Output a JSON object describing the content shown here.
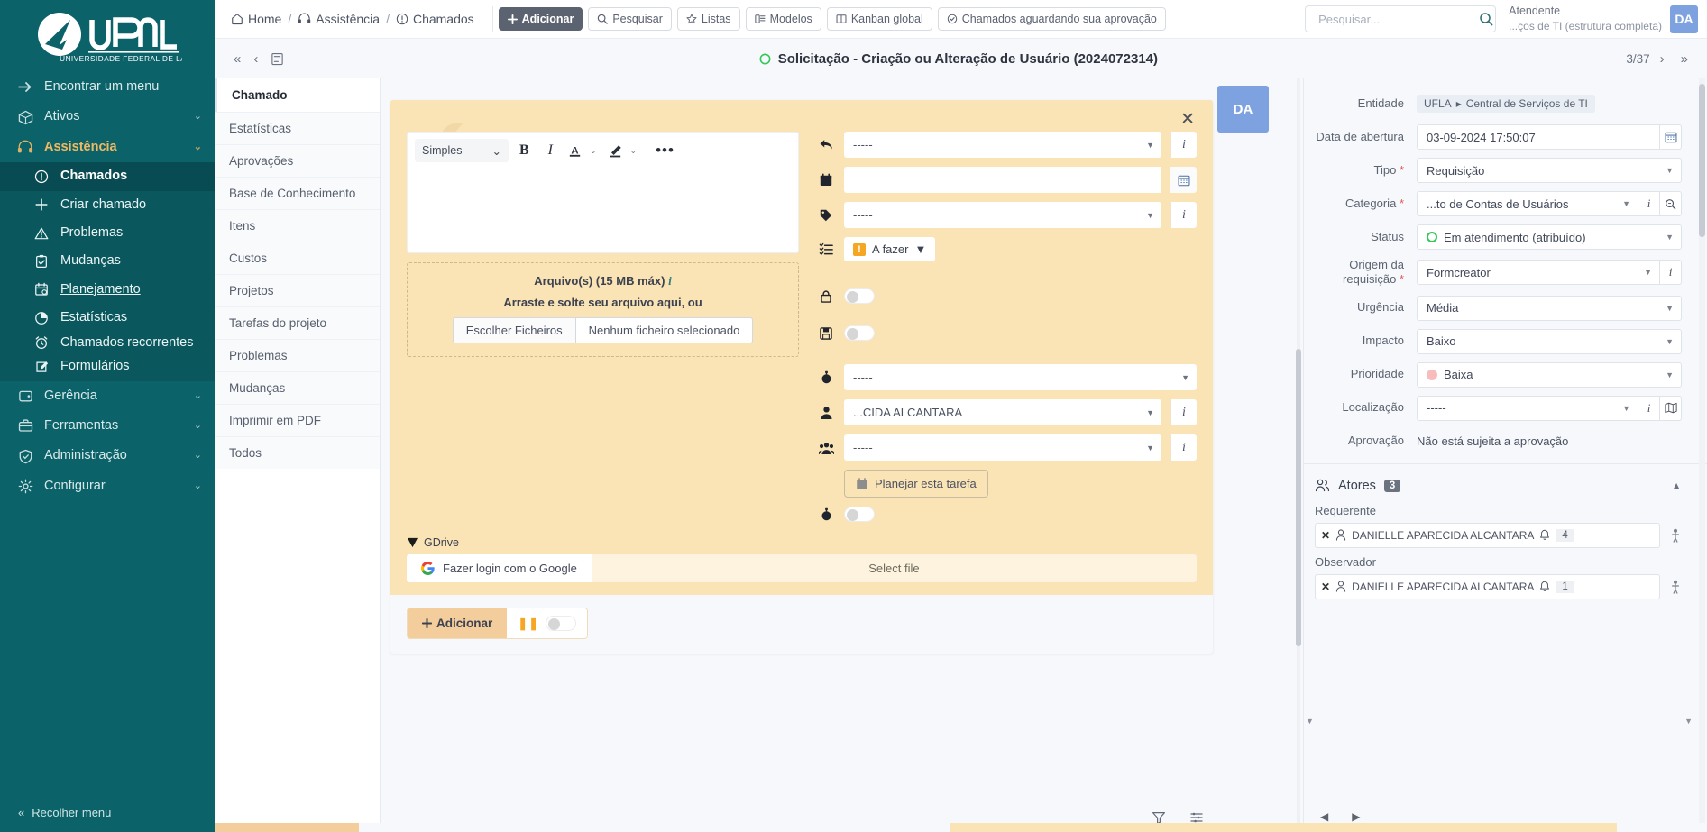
{
  "sidebar": {
    "logo_text": "UFLA",
    "logo_sub": "UNIVERSIDADE FEDERAL DE LAVRAS",
    "find_menu": "Encontrar um menu",
    "items": [
      {
        "label": "Ativos",
        "icon": "box-icon"
      },
      {
        "label": "Assistência",
        "icon": "headset-icon"
      }
    ],
    "sub_items": [
      {
        "label": "Chamados",
        "icon": "exclamation-circle-icon"
      },
      {
        "label": "Criar chamado",
        "icon": "plus-icon"
      },
      {
        "label": "Problemas",
        "icon": "warning-triangle-icon"
      },
      {
        "label": "Mudanças",
        "icon": "clipboard-check-icon"
      },
      {
        "label": "Planejamento",
        "icon": "calendar-clock-icon"
      },
      {
        "label": "Estatísticas",
        "icon": "pie-chart-icon"
      },
      {
        "label": "Chamados recorrentes",
        "icon": "alarm-clock-icon"
      },
      {
        "label": "Formulários",
        "icon": "edit-square-icon"
      }
    ],
    "items_after": [
      {
        "label": "Gerência",
        "icon": "wallet-icon"
      },
      {
        "label": "Ferramentas",
        "icon": "briefcase-icon"
      },
      {
        "label": "Administração",
        "icon": "shield-check-icon"
      },
      {
        "label": "Configurar",
        "icon": "gear-icon"
      }
    ],
    "collapse_label": "Recolher menu"
  },
  "topbar": {
    "breadcrumb": [
      {
        "label": "Home",
        "icon": "home-icon"
      },
      {
        "label": "Assistência",
        "icon": "headset-icon"
      },
      {
        "label": "Chamados",
        "icon": "exclamation-circle-icon"
      }
    ],
    "buttons": [
      {
        "label": "Adicionar",
        "icon": "plus-icon",
        "primary": true
      },
      {
        "label": "Pesquisar",
        "icon": "search-icon",
        "primary": false
      },
      {
        "label": "Listas",
        "icon": "star-icon",
        "primary": false
      },
      {
        "label": "Modelos",
        "icon": "template-icon",
        "primary": false
      },
      {
        "label": "Kanban global",
        "icon": "kanban-icon",
        "primary": false
      },
      {
        "label": "Chamados aguardando sua aprovação",
        "icon": "clock-check-icon",
        "primary": false
      }
    ],
    "search_placeholder": "Pesquisar...",
    "user_role": "Atendente",
    "user_entity": "...ços de TI (estrutura completa)",
    "user_initials": "DA"
  },
  "title_row": {
    "ticket_title": "Solicitação - Criação ou Alteração de Usuário (2024072314)",
    "status_icon": "green-ring-icon",
    "pager": "3/37"
  },
  "tabs": {
    "header": "Chamado",
    "items": [
      "Estatísticas",
      "Aprovações",
      "Base de Conhecimento",
      "Itens",
      "Custos",
      "Projetos",
      "Tarefas do projeto",
      "Problemas",
      "Mudanças",
      "Imprimir em PDF",
      "Todos"
    ]
  },
  "card": {
    "avatar_initials": "DA",
    "editor": {
      "style_select": "Simples",
      "bold": "B",
      "italic": "I",
      "more": "•••",
      "content": ""
    },
    "upload": {
      "title": "Arquivo(s) (15 MB máx)",
      "info": "i",
      "drop_text": "Arraste e solte seu arquivo aqui, ou",
      "choose_button": "Escolher Ficheiros",
      "no_file": "Nenhum ficheiro selecionado"
    },
    "controls": [
      {
        "icon": "reply-icon",
        "type": "select",
        "value": "-----",
        "has_info": true
      },
      {
        "icon": "calendar-icon",
        "type": "date",
        "value": "",
        "has_info": false
      },
      {
        "icon": "tag-icon",
        "type": "select",
        "value": "-----",
        "has_info": true
      },
      {
        "icon": "task-list-icon",
        "type": "pill",
        "value": "A fazer",
        "badge": "!"
      },
      {
        "icon": "lock-icon",
        "type": "toggle",
        "value": ""
      },
      {
        "icon": "save-icon",
        "type": "toggle",
        "value": ""
      },
      {
        "icon": "stopwatch-icon",
        "type": "select-nobtn",
        "value": "-----"
      },
      {
        "icon": "user-icon",
        "type": "select",
        "value": "...CIDA ALCANTARA",
        "has_info": true
      },
      {
        "icon": "group-icon",
        "type": "select",
        "value": "-----",
        "has_info": true
      }
    ],
    "plan_button": "Planejar esta tarefa",
    "plan_toggle_icon": "stopwatch-icon",
    "gdrive": {
      "label": "GDrive",
      "login_button": "Fazer login com o Google",
      "select_file": "Select file"
    },
    "footer": {
      "add_button": "Adicionar",
      "pause_icon": "pause-icon"
    },
    "close_icon": "close-icon"
  },
  "right_panel": {
    "fields": [
      {
        "label": "Entidade",
        "type": "entity",
        "value": "UFLA",
        "value2": "Central de Serviços de TI",
        "required": false
      },
      {
        "label": "Data de abertura",
        "type": "date",
        "value": "03-09-2024 17:50:07",
        "required": false
      },
      {
        "label": "Tipo",
        "type": "select",
        "value": "Requisição",
        "required": true
      },
      {
        "label": "Categoria",
        "type": "select-info-search",
        "value": "...to de Contas de Usuários",
        "required": true
      },
      {
        "label": "Status",
        "type": "select-ring",
        "value": "Em atendimento (atribuído)",
        "required": false
      },
      {
        "label": "Origem da requisição",
        "type": "select-info",
        "value": "Formcreator",
        "required": true
      },
      {
        "label": "Urgência",
        "type": "select",
        "value": "Média",
        "required": false
      },
      {
        "label": "Impacto",
        "type": "select",
        "value": "Baixo",
        "required": false
      },
      {
        "label": "Prioridade",
        "type": "select-dot",
        "value": "Baixa",
        "dot_color": "#f7bdbd",
        "required": false
      },
      {
        "label": "Localização",
        "type": "select-info-map",
        "value": "-----",
        "required": false
      },
      {
        "label": "Aprovação",
        "type": "text",
        "value": "Não está sujeita a aprovação",
        "required": false
      }
    ],
    "actors": {
      "title": "Atores",
      "count": "3",
      "groups": [
        {
          "label": "Requerente",
          "chip_name": "DANIELLE APARECIDA ALCANTARA",
          "chip_count": "4"
        },
        {
          "label": "Observador",
          "chip_name": "DANIELLE APARECIDA ALCANTARA",
          "chip_count": "1"
        }
      ]
    }
  },
  "colors": {
    "sidebar_bg": "#0b6269",
    "accent": "#f0b963",
    "card_bg": "#fae3b4",
    "primary_btn": "#5b6270",
    "avatar": "#7ea2e0"
  }
}
